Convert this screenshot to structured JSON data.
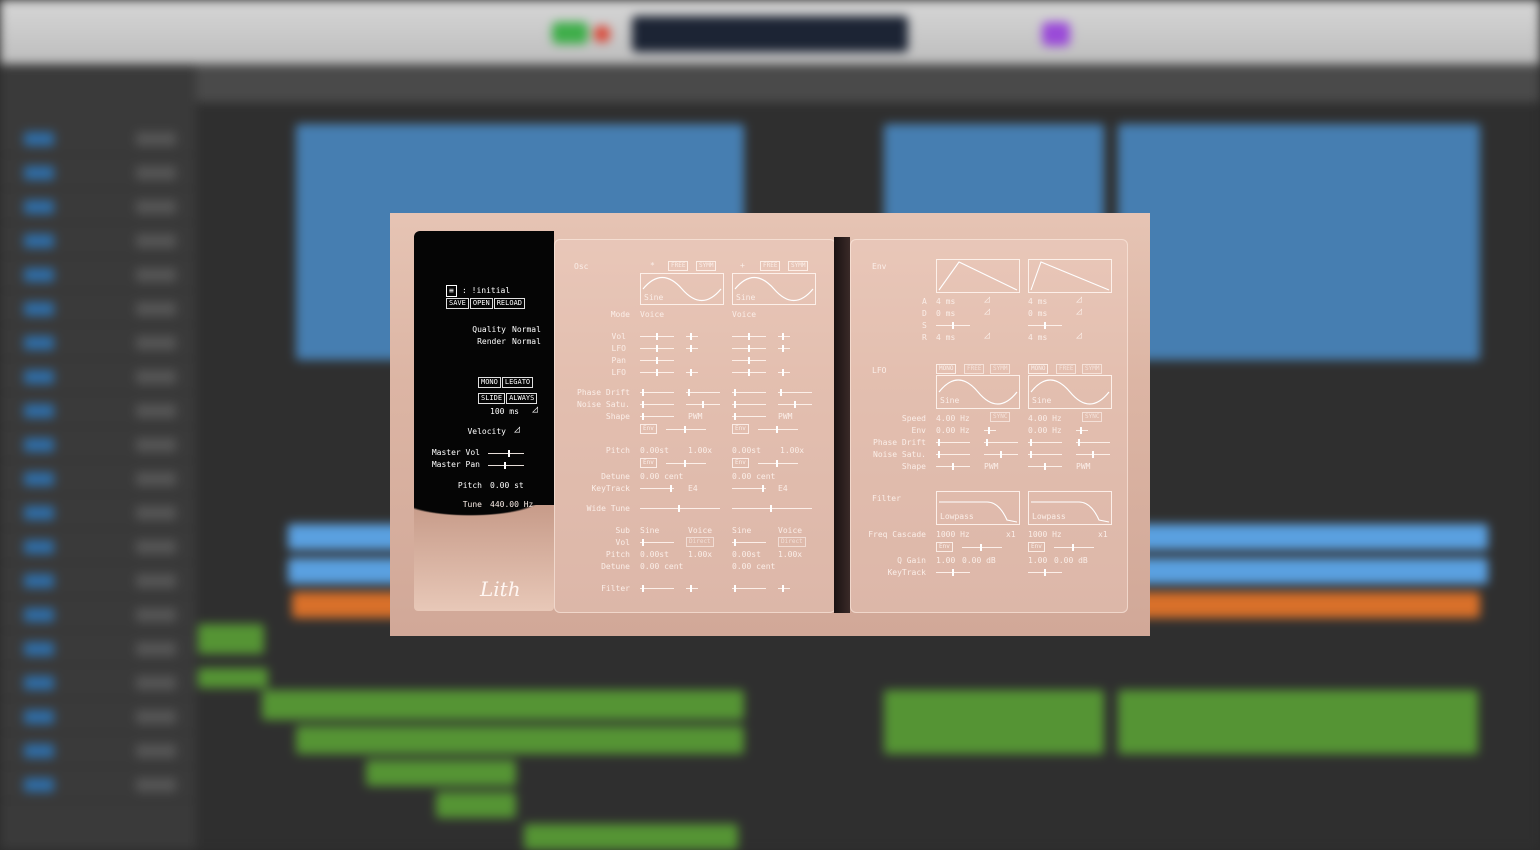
{
  "plugin": {
    "preset": {
      "menu_icon": "≡",
      "name": ": !initial",
      "save": "SAVE",
      "open": "OPEN",
      "reload": "RELOAD"
    },
    "quality_label": "Quality",
    "quality_value": "Normal",
    "render_label": "Render",
    "render_value": "Normal",
    "mono": "MONO",
    "legato": "LEGATO",
    "slide": "SLIDE",
    "always": "ALWAYS",
    "glide_time": "100 ms",
    "velocity_label": "Velocity",
    "master_vol": "Master Vol",
    "master_pan": "Master Pan",
    "pitch_label": "Pitch",
    "pitch_value": "0.00 st",
    "tune_label": "Tune",
    "tune_value": "440.00 Hz",
    "logo": "Lith"
  },
  "osc": {
    "title": "Osc",
    "free": "FREE",
    "symm": "SYMM",
    "col1": {
      "marker": "*",
      "wave": "Sine",
      "mode": "Voice",
      "shape": "PWM",
      "env": "Env",
      "pitch": "0.00st",
      "ratio": "1.00x",
      "detune": "0.00 cent",
      "keytrack": "E4",
      "sub": "Sine",
      "sub_mode": "Voice",
      "sub_direct": "Direct",
      "sub_pitch": "0.00st",
      "sub_ratio": "1.00x",
      "sub_detune": "0.00 cent"
    },
    "col2": {
      "marker": "+",
      "wave": "Sine",
      "mode": "Voice",
      "shape": "PWM",
      "env": "Env",
      "pitch": "0.00st",
      "ratio": "1.00x",
      "detune": "0.00 cent",
      "keytrack": "E4",
      "sub": "Sine",
      "sub_mode": "Voice",
      "sub_direct": "Direct",
      "sub_pitch": "0.00st",
      "sub_ratio": "1.00x",
      "sub_detune": "0.00 cent"
    },
    "labels": {
      "mode": "Mode",
      "vol": "Vol",
      "lfo": "LFO",
      "pan": "Pan",
      "lfo2": "LFO",
      "phase_drift": "Phase Drift",
      "noise_satu": "Noise Satu.",
      "shape": "Shape",
      "pitch": "Pitch",
      "detune": "Detune",
      "keytrack": "KeyTrack",
      "wide_tune": "Wide Tune",
      "sub": "Sub",
      "sub_vol": "Vol",
      "sub_pitch": "Pitch",
      "sub_detune": "Detune",
      "filter": "Filter"
    }
  },
  "env": {
    "title": "Env",
    "labels": {
      "a": "A",
      "d": "D",
      "s": "S",
      "r": "R"
    },
    "col1": {
      "a": "4 ms",
      "d": "0 ms",
      "r": "4 ms"
    },
    "col2": {
      "a": "4 ms",
      "d": "0 ms",
      "r": "4 ms"
    }
  },
  "lfo": {
    "title": "LFO",
    "mono": "MONO",
    "free": "FREE",
    "symm": "SYMM",
    "sync": "SYNC",
    "labels": {
      "speed": "Speed",
      "env": "Env",
      "phase_drift": "Phase Drift",
      "noise_satu": "Noise Satu.",
      "shape": "Shape"
    },
    "col1": {
      "wave": "Sine",
      "speed": "4.00 Hz",
      "env": "0.00 Hz",
      "shape": "PWM"
    },
    "col2": {
      "wave": "Sine",
      "speed": "4.00 Hz",
      "env": "0.00 Hz",
      "shape": "PWM"
    }
  },
  "filter": {
    "title": "Filter",
    "labels": {
      "freq_cascade": "Freq Cascade",
      "q_gain": "Q Gain",
      "keytrack": "KeyTrack"
    },
    "col1": {
      "type": "Lowpass",
      "freq": "1000 Hz",
      "cascade": "x1",
      "env": "Env",
      "q": "1.00",
      "gain": "0.00 dB"
    },
    "col2": {
      "type": "Lowpass",
      "freq": "1000 Hz",
      "cascade": "x1",
      "env": "Env",
      "q": "1.00",
      "gain": "0.00 dB"
    }
  }
}
